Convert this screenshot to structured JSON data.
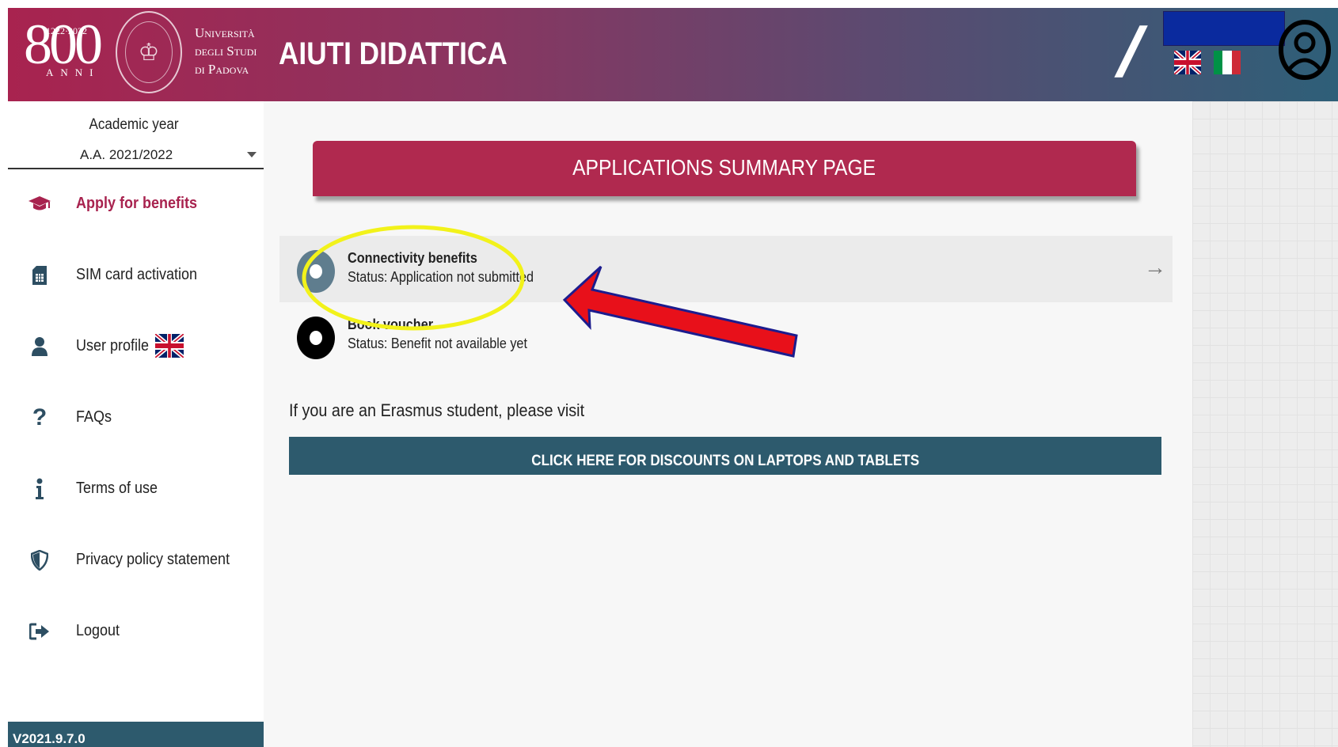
{
  "header": {
    "logo_years": "1222·2022",
    "logo_number": "800",
    "logo_anni": "ANNI",
    "university_lines": [
      "Università",
      "degli Studi",
      "di Padova"
    ],
    "app_title": "AIUTI DIDATTICA",
    "separator": "/",
    "languages": [
      "flag-uk-icon",
      "flag-it-icon"
    ],
    "colors": {
      "gradient_start": "#a8234f",
      "gradient_end": "#2e5f78"
    }
  },
  "sidebar": {
    "academic_year_label": "Academic year",
    "academic_year_value": "A.A. 2021/2022",
    "items": [
      {
        "label": "Apply for benefits",
        "icon": "graduation-cap-icon",
        "active": true
      },
      {
        "label": "SIM card activation",
        "icon": "sim-card-icon",
        "active": false
      },
      {
        "label": "User profile",
        "icon": "user-icon",
        "active": false
      },
      {
        "label": "FAQs",
        "icon": "question-icon",
        "active": false
      },
      {
        "label": "Terms of use",
        "icon": "info-icon",
        "active": false
      },
      {
        "label": "Privacy policy statement",
        "icon": "shield-icon",
        "active": false
      },
      {
        "label": "Logout",
        "icon": "logout-icon",
        "active": false
      }
    ],
    "version": "V2021.9.7.0"
  },
  "main": {
    "banner_title": "APPLICATIONS SUMMARY PAGE",
    "benefits": [
      {
        "title": "Connectivity benefits",
        "status": "Status: Application not submitted",
        "circle_color": "#5f7d8e"
      },
      {
        "title": "Book voucher",
        "status": "Status: Benefit not available yet",
        "circle_color": "#000000"
      }
    ],
    "erasmus_text": "If you are an Erasmus student, please visit",
    "laptop_button": "CLICK HERE FOR DISCOUNTS ON LAPTOPS AND TABLETS"
  },
  "colors": {
    "accent": "#a8234f",
    "primary_dark": "#2d5a6d",
    "annotation_yellow": "#f2f21a",
    "annotation_red": "#e8101a"
  }
}
